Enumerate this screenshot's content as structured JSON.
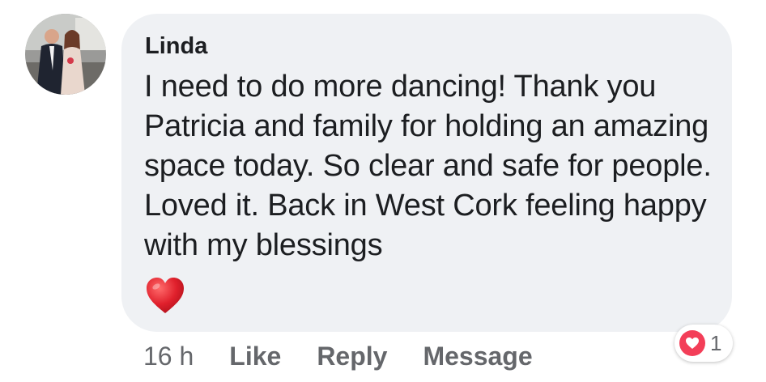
{
  "comment": {
    "author": "Linda",
    "text": "I need to do more dancing! Thank you Patricia and family for holding an amazing space today. So clear and safe for people. Loved it. Back in West Cork feeling happy with my blessings",
    "emoji": "red-heart"
  },
  "actions": {
    "time": "16 h",
    "like_label": "Like",
    "reply_label": "Reply",
    "message_label": "Message"
  },
  "reactions": {
    "icon": "heart-reaction-icon",
    "count": "1"
  },
  "colors": {
    "bubble": "#eff1f4",
    "text": "#1c1e21",
    "secondary_text": "#65676b",
    "heart_reaction": "#f33e58",
    "heart_emoji": "#e0202c"
  }
}
